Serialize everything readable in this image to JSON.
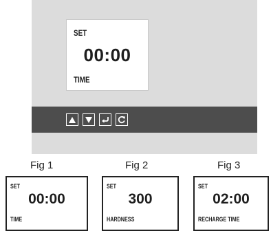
{
  "main_display": {
    "set_label": "SET",
    "value": "00:00",
    "bottom_label": "TIME"
  },
  "buttons": [
    {
      "icon": "arrow-up-icon"
    },
    {
      "icon": "arrow-down-icon"
    },
    {
      "icon": "enter-icon"
    },
    {
      "icon": "refresh-icon"
    }
  ],
  "figures": [
    {
      "title": "Fig 1",
      "set_label": "SET",
      "value": "00:00",
      "bottom_label": "TIME"
    },
    {
      "title": "Fig 2",
      "set_label": "SET",
      "value": "300",
      "bottom_label": "HARDNESS"
    },
    {
      "title": "Fig 3",
      "set_label": "SET",
      "value": "02:00",
      "bottom_label": "RECHARGE TIME"
    }
  ],
  "colors": {
    "panel_bg": "#dcdcdc",
    "button_bar_bg": "#4d4d4d",
    "display_bg": "#ffffff",
    "text": "#1e1e1e"
  }
}
